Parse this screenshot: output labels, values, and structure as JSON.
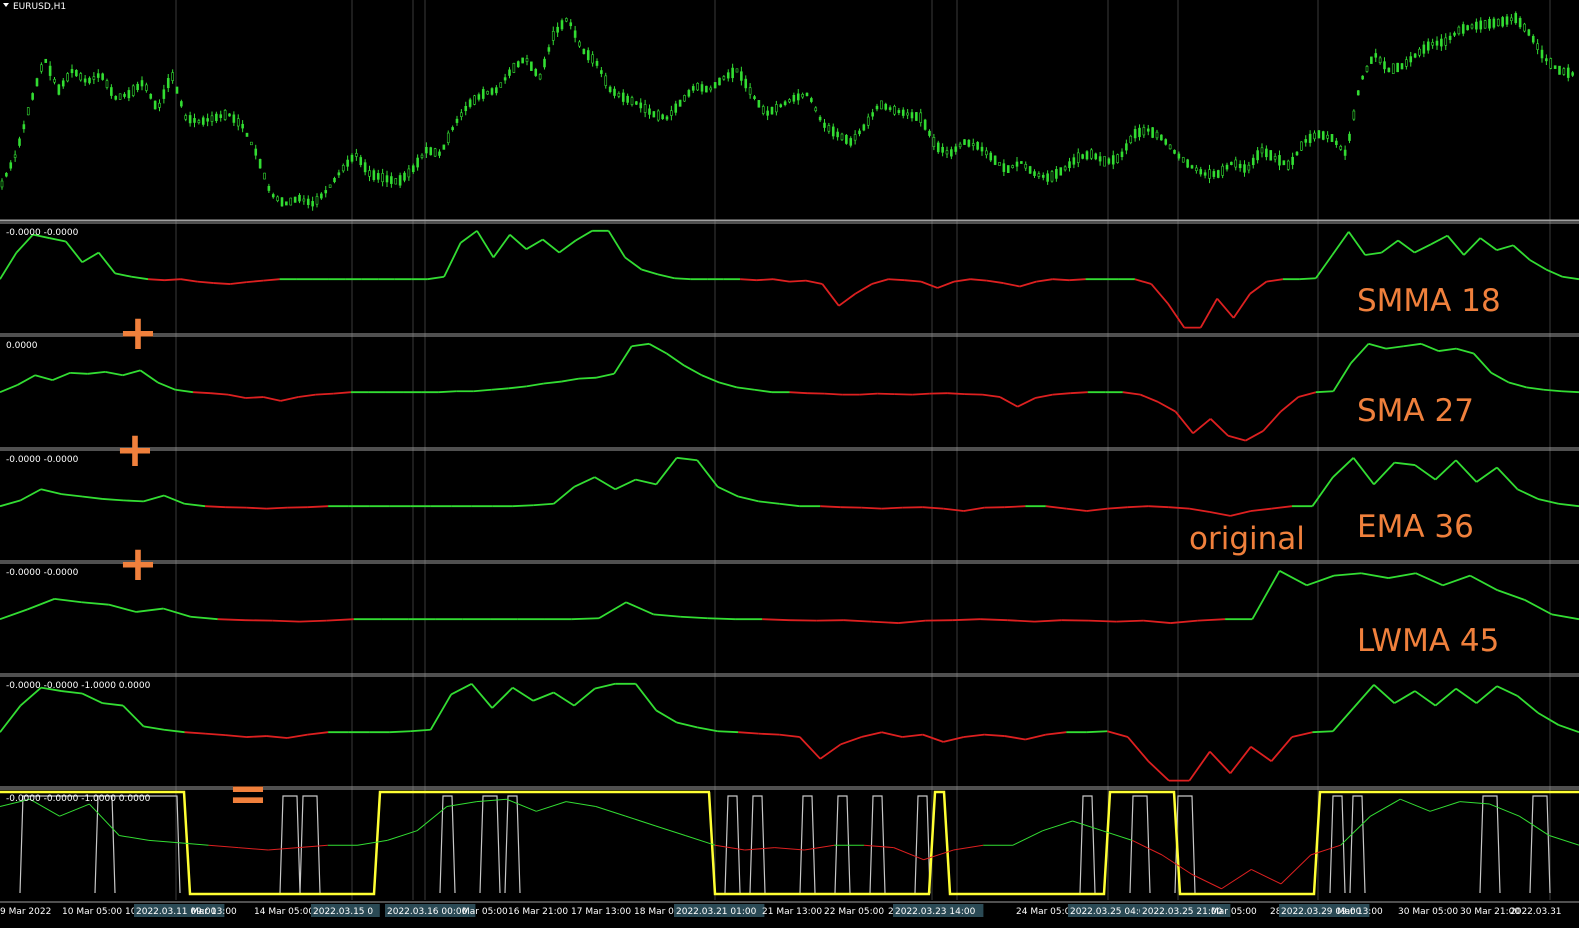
{
  "window": {
    "symbol_title": "EURUSD,H1",
    "menu_icon": "triangle-down-icon"
  },
  "colors": {
    "background": "#000000",
    "grid": "#3a3a3a",
    "separator": "#a0a0a0",
    "candle": "#33dd33",
    "bull": "#33dd33",
    "bear": "#dd2020",
    "gray_line": "#c8c8c8",
    "yellow_line": "#ffff33",
    "annotation": "#f0803c"
  },
  "price_pane": {
    "series": [
      0.15,
      0.3,
      0.55,
      0.78,
      0.62,
      0.72,
      0.66,
      0.7,
      0.58,
      0.6,
      0.66,
      0.52,
      0.7,
      0.48,
      0.46,
      0.48,
      0.5,
      0.44,
      0.3,
      0.1,
      0.05,
      0.08,
      0.05,
      0.12,
      0.22,
      0.3,
      0.2,
      0.18,
      0.16,
      0.22,
      0.32,
      0.3,
      0.45,
      0.55,
      0.6,
      0.62,
      0.72,
      0.78,
      0.68,
      0.9,
      0.98,
      0.82,
      0.76,
      0.62,
      0.58,
      0.55,
      0.5,
      0.48,
      0.56,
      0.64,
      0.62,
      0.68,
      0.72,
      0.6,
      0.5,
      0.54,
      0.58,
      0.6,
      0.45,
      0.4,
      0.36,
      0.44,
      0.55,
      0.52,
      0.5,
      0.48,
      0.34,
      0.3,
      0.36,
      0.34,
      0.28,
      0.22,
      0.26,
      0.2,
      0.18,
      0.22,
      0.28,
      0.3,
      0.26,
      0.28,
      0.4,
      0.42,
      0.38,
      0.3,
      0.24,
      0.2,
      0.2,
      0.26,
      0.22,
      0.32,
      0.28,
      0.24,
      0.36,
      0.4,
      0.38,
      0.3,
      0.66,
      0.8,
      0.72,
      0.74,
      0.8,
      0.85,
      0.86,
      0.92,
      0.94,
      0.95,
      0.96,
      0.98,
      0.9,
      0.78,
      0.72,
      0.7
    ]
  },
  "panes": [
    {
      "label": "-0.0000 -0.0000",
      "annotation": "SMMA 18",
      "series": [
        0.0,
        0.55,
        0.92,
        0.85,
        0.78,
        0.35,
        0.55,
        0.12,
        0.05,
        0.0,
        -0.02,
        0.0,
        -0.05,
        -0.08,
        -0.1,
        -0.06,
        -0.03,
        0.0,
        0.0,
        0.0,
        0.0,
        0.0,
        0.0,
        0.0,
        0.0,
        0.0,
        0.0,
        0.05,
        0.75,
        1.0,
        0.45,
        0.92,
        0.62,
        0.82,
        0.55,
        0.8,
        1.0,
        1.0,
        0.45,
        0.2,
        0.1,
        0.02,
        0.0,
        0.0,
        0.0,
        0.0,
        -0.02,
        0.0,
        -0.05,
        -0.03,
        -0.1,
        -0.55,
        -0.3,
        -0.1,
        0.0,
        -0.02,
        -0.05,
        -0.18,
        -0.05,
        0.0,
        -0.03,
        -0.08,
        -0.15,
        -0.05,
        0.0,
        -0.02,
        0.0,
        0.0,
        0.0,
        0.0,
        -0.1,
        -0.5,
        -1.0,
        -1.0,
        -0.4,
        -0.8,
        -0.3,
        -0.05,
        0.0,
        0.0,
        0.02,
        0.5,
        0.98,
        0.5,
        0.55,
        0.8,
        0.55,
        0.72,
        0.9,
        0.5,
        0.85,
        0.6,
        0.7,
        0.4,
        0.2,
        0.05,
        0.0
      ]
    },
    {
      "label": "0.0000",
      "annotation": "SMA 27",
      "series": [
        0.0,
        0.15,
        0.35,
        0.25,
        0.4,
        0.38,
        0.42,
        0.35,
        0.45,
        0.2,
        0.05,
        0.0,
        -0.02,
        -0.05,
        -0.12,
        -0.1,
        -0.18,
        -0.1,
        -0.05,
        -0.03,
        0.0,
        0.0,
        0.0,
        0.0,
        0.0,
        0.0,
        0.02,
        0.02,
        0.05,
        0.08,
        0.12,
        0.18,
        0.22,
        0.28,
        0.3,
        0.38,
        0.95,
        1.0,
        0.8,
        0.55,
        0.35,
        0.2,
        0.1,
        0.05,
        0.0,
        0.0,
        -0.02,
        -0.03,
        -0.05,
        -0.05,
        -0.03,
        -0.04,
        -0.05,
        -0.03,
        -0.02,
        -0.04,
        -0.05,
        -0.1,
        -0.3,
        -0.12,
        -0.05,
        -0.02,
        0.0,
        0.0,
        0.0,
        -0.05,
        -0.2,
        -0.4,
        -0.85,
        -0.55,
        -0.9,
        -1.0,
        -0.8,
        -0.4,
        -0.1,
        0.0,
        0.02,
        0.6,
        1.0,
        0.9,
        0.95,
        1.0,
        0.85,
        0.9,
        0.8,
        0.4,
        0.2,
        0.1,
        0.05,
        0.02,
        0.0
      ]
    },
    {
      "label": "-0.0000 -0.0000",
      "annotation": "EMA 36",
      "annotation_extra": "original",
      "series": [
        0.0,
        0.12,
        0.35,
        0.25,
        0.2,
        0.15,
        0.12,
        0.1,
        0.22,
        0.05,
        0.0,
        -0.02,
        -0.03,
        -0.05,
        -0.03,
        -0.02,
        0.0,
        0.0,
        0.0,
        0.0,
        0.0,
        0.0,
        0.0,
        0.0,
        0.0,
        0.0,
        0.02,
        0.05,
        0.4,
        0.6,
        0.35,
        0.55,
        0.45,
        1.0,
        0.95,
        0.4,
        0.2,
        0.1,
        0.05,
        0.0,
        0.0,
        -0.02,
        -0.03,
        -0.05,
        -0.03,
        -0.02,
        -0.05,
        -0.1,
        -0.03,
        -0.02,
        0.0,
        0.0,
        -0.05,
        -0.1,
        -0.05,
        -0.02,
        0.0,
        -0.02,
        -0.05,
        -0.12,
        -0.2,
        -0.1,
        -0.05,
        0.0,
        0.0,
        0.6,
        1.0,
        0.45,
        0.9,
        0.85,
        0.55,
        0.95,
        0.5,
        0.8,
        0.35,
        0.15,
        0.05,
        0.0
      ]
    },
    {
      "label": "-0.0000 -0.0000",
      "annotation": "LWMA 45",
      "series": [
        0.0,
        0.2,
        0.42,
        0.35,
        0.3,
        0.15,
        0.22,
        0.05,
        0.0,
        -0.02,
        -0.03,
        -0.05,
        -0.03,
        0.0,
        0.0,
        0.0,
        0.0,
        0.0,
        0.0,
        0.0,
        0.0,
        0.0,
        0.02,
        0.35,
        0.1,
        0.05,
        0.02,
        0.0,
        0.0,
        -0.02,
        -0.03,
        -0.02,
        -0.05,
        -0.08,
        -0.03,
        -0.02,
        0.0,
        -0.02,
        -0.05,
        -0.02,
        -0.03,
        -0.05,
        -0.03,
        -0.08,
        -0.03,
        0.0,
        0.0,
        1.0,
        0.7,
        0.9,
        0.95,
        0.85,
        0.95,
        0.7,
        0.9,
        0.6,
        0.4,
        0.1,
        0.0
      ]
    },
    {
      "label": "-0.0000 -0.0000 -1.0000 0.0000",
      "series": [
        0.0,
        0.55,
        0.92,
        0.85,
        0.8,
        0.6,
        0.55,
        0.12,
        0.05,
        0.0,
        -0.03,
        -0.06,
        -0.1,
        -0.08,
        -0.12,
        -0.05,
        0.0,
        0.0,
        0.0,
        0.0,
        0.02,
        0.05,
        0.78,
        1.0,
        0.5,
        0.92,
        0.65,
        0.82,
        0.55,
        0.9,
        1.0,
        1.0,
        0.45,
        0.2,
        0.1,
        0.02,
        0.0,
        -0.03,
        -0.05,
        -0.1,
        -0.55,
        -0.25,
        -0.1,
        0.0,
        -0.1,
        -0.05,
        -0.2,
        -0.1,
        -0.05,
        -0.08,
        -0.15,
        -0.05,
        0.0,
        0.0,
        0.02,
        -0.1,
        -0.6,
        -1.0,
        -1.0,
        -0.4,
        -0.85,
        -0.3,
        -0.6,
        -0.1,
        0.0,
        0.02,
        0.5,
        0.98,
        0.6,
        0.85,
        0.55,
        0.9,
        0.6,
        0.95,
        0.75,
        0.4,
        0.15,
        0.0
      ]
    },
    {
      "label": "-0.0000 -0.0000 -1.0000 0.0000",
      "series": [
        0.8,
        0.95,
        0.6,
        0.85,
        0.2,
        0.1,
        0.05,
        0.0,
        -0.05,
        -0.1,
        -0.05,
        0.0,
        0.0,
        0.1,
        0.3,
        0.8,
        0.9,
        0.95,
        0.7,
        0.9,
        0.8,
        0.6,
        0.4,
        0.2,
        0.0,
        -0.1,
        -0.05,
        -0.1,
        0.0,
        0.0,
        -0.05,
        -0.3,
        -0.1,
        0.0,
        0.0,
        0.3,
        0.5,
        0.3,
        0.1,
        -0.2,
        -0.6,
        -0.9,
        -0.5,
        -0.8,
        -0.2,
        0.0,
        0.6,
        0.95,
        0.7,
        0.9,
        0.85,
        0.6,
        0.2,
        0.0
      ],
      "yellow_signal": [
        1,
        1,
        1,
        0,
        0,
        0,
        0,
        0,
        0,
        1,
        1,
        1,
        1,
        1,
        1,
        0,
        0,
        0,
        0,
        1,
        0,
        0,
        0,
        1,
        1,
        0,
        0,
        0,
        1,
        1,
        1,
        1,
        1
      ],
      "yellow_x": [
        0,
        130,
        170,
        190,
        230,
        290,
        320,
        350,
        355,
        380,
        410,
        430,
        600,
        700,
        710,
        715,
        740,
        800,
        930,
        935,
        950,
        1000,
        1100,
        1110,
        1170,
        1180,
        1250,
        1300,
        1320,
        1400,
        1520,
        1545,
        1579
      ],
      "gray_spikes": [
        [
          20,
          180
        ],
        [
          95,
          115
        ],
        [
          280,
          300
        ],
        [
          300,
          320
        ],
        [
          440,
          455
        ],
        [
          480,
          500
        ],
        [
          505,
          520
        ],
        [
          725,
          740
        ],
        [
          750,
          765
        ],
        [
          800,
          815
        ],
        [
          835,
          850
        ],
        [
          870,
          885
        ],
        [
          915,
          930
        ],
        [
          1080,
          1095
        ],
        [
          1130,
          1150
        ],
        [
          1175,
          1195
        ],
        [
          1330,
          1345
        ],
        [
          1350,
          1365
        ],
        [
          1480,
          1500
        ],
        [
          1530,
          1550
        ]
      ]
    }
  ],
  "operators": [
    "+",
    "+",
    "+",
    "="
  ],
  "time_axis": {
    "labels": [
      {
        "text": "9 Mar 2022"
      },
      {
        "text": "10 Mar 05:00"
      },
      {
        "text": "10"
      },
      {
        "text": "2022.03.11 09:00",
        "hl": true
      },
      {
        "text": "Mar 13:00"
      },
      {
        "text": "14 Mar 05:00"
      },
      {
        "text": "2022.03.15 0",
        "hl": true
      },
      {
        "text": "2022.03.16 00:00",
        "hl": true
      },
      {
        "text": "Mar 05:00"
      },
      {
        "text": "16 Mar 21:00"
      },
      {
        "text": "17 Mar 13:00"
      },
      {
        "text": "18 Mar 05"
      },
      {
        "text": "2022.03.21 01:00",
        "hl": true
      },
      {
        "text": "21 Mar 13:00"
      },
      {
        "text": "22 Mar 05:00"
      },
      {
        "text": "2"
      },
      {
        "text": "2022.03.23 14:00",
        "hl": true
      },
      {
        "text": "24 Mar 05:00"
      },
      {
        "text": "2022.03.25 04:0",
        "hl": true
      },
      {
        "text": "2022.03.25 21:00",
        "hl": true
      },
      {
        "text": "Mar 05:00"
      },
      {
        "text": "28"
      },
      {
        "text": "2022.03.29 09:00",
        "hl": true
      },
      {
        "text": "Mar 13:00"
      },
      {
        "text": "30 Mar 05:00"
      },
      {
        "text": "30 Mar 21:00"
      },
      {
        "text": "2022.03.31"
      }
    ]
  }
}
